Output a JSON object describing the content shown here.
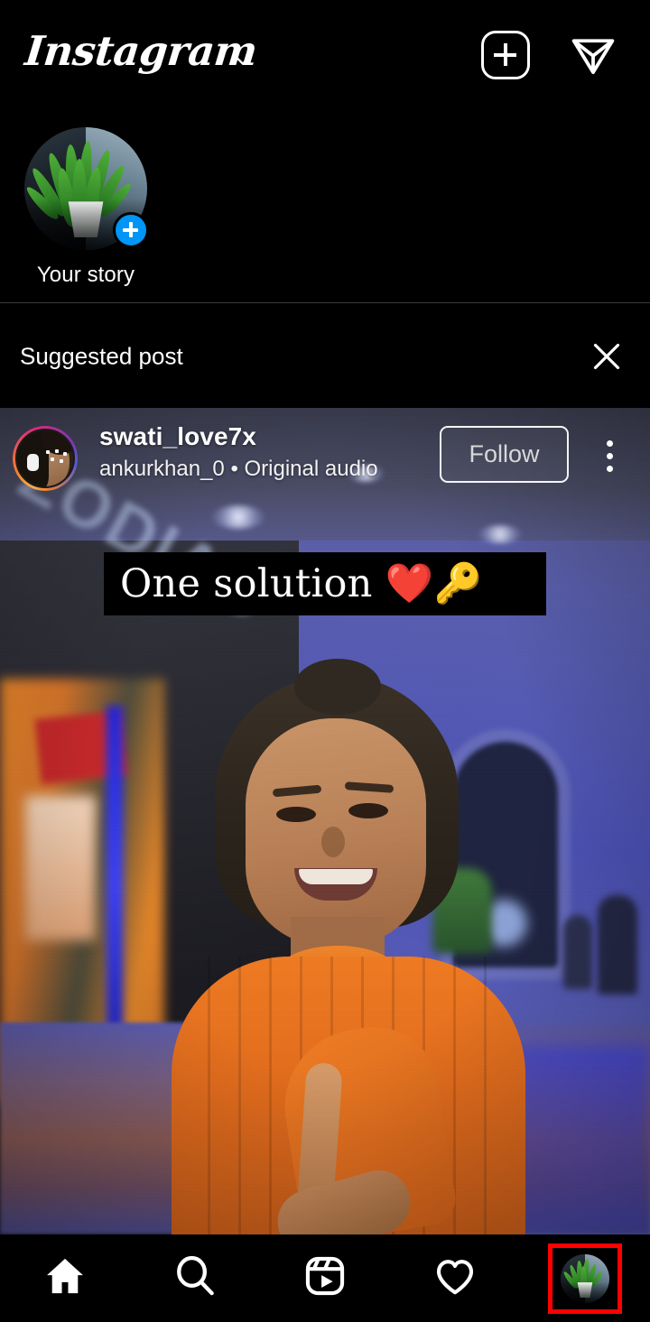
{
  "app": {
    "name": "Instagram",
    "theme": "dark"
  },
  "header": {
    "logo_text": "Instagram",
    "chevron_icon": "chevron-down-icon",
    "actions": [
      {
        "name": "new-post-button",
        "icon": "plus-square-icon"
      },
      {
        "name": "direct-messages-button",
        "icon": "send-paper-plane-icon"
      }
    ]
  },
  "stories": {
    "items": [
      {
        "label": "Your story",
        "avatar_alt": "potted green plant",
        "has_add_badge": true,
        "badge_icon": "plus-icon",
        "badge_color": "#0095F6"
      }
    ]
  },
  "suggested": {
    "label": "Suggested post",
    "close_icon": "close-x-icon"
  },
  "post": {
    "username": "swati_love7x",
    "subtitle": "ankurkhan_0 • Original audio",
    "follow_label": "Follow",
    "more_icon": "three-dots-vertical-icon",
    "avatar_alt": "woman with earbuds, gradient story ring",
    "overlay_text": "One solution ❤️🔑",
    "media_alt": "woman in orange ribbed turtleneck pointing upward in a blue-lit corridor with blurred ZODIAC signage",
    "media_background_sign": "ZODIAC"
  },
  "bottom_nav": {
    "items": [
      {
        "name": "nav-home",
        "icon": "home-icon",
        "active": true
      },
      {
        "name": "nav-search",
        "icon": "search-magnifier-icon",
        "active": false
      },
      {
        "name": "nav-reels",
        "icon": "reels-play-icon",
        "active": false
      },
      {
        "name": "nav-activity",
        "icon": "heart-outline-icon",
        "active": false
      },
      {
        "name": "nav-profile",
        "icon": "profile-avatar-icon",
        "active": false,
        "highlighted": true
      }
    ],
    "highlight_color": "#FF0000"
  }
}
